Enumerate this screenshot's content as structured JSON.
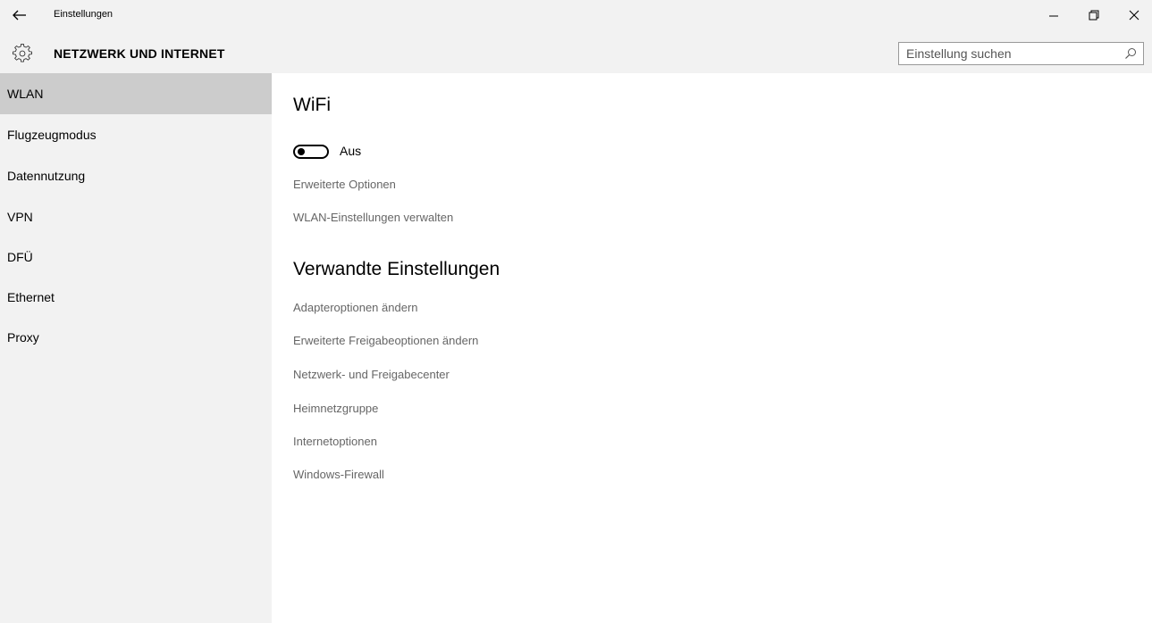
{
  "window": {
    "title": "Einstellungen",
    "controls": {
      "back": "arrow-left-icon",
      "minimize": "minimize-icon",
      "maximize": "restore-icon",
      "close": "close-icon"
    }
  },
  "header": {
    "icon": "gear-icon",
    "title": "NETZWERK UND INTERNET",
    "search": {
      "placeholder": "Einstellung suchen",
      "value": "",
      "icon": "search-icon"
    }
  },
  "sidebar": {
    "items": [
      {
        "label": "WLAN",
        "selected": true
      },
      {
        "label": "Flugzeugmodus",
        "selected": false
      },
      {
        "label": "Datennutzung",
        "selected": false
      },
      {
        "label": "VPN",
        "selected": false
      },
      {
        "label": "DFÜ",
        "selected": false
      },
      {
        "label": "Ethernet",
        "selected": false
      },
      {
        "label": "Proxy",
        "selected": false
      }
    ]
  },
  "main": {
    "wifi": {
      "heading": "WiFi",
      "toggle": {
        "state": "off",
        "label": "Aus"
      },
      "links": [
        "Erweiterte Optionen",
        "WLAN-Einstellungen verwalten"
      ]
    },
    "related": {
      "heading": "Verwandte Einstellungen",
      "links": [
        "Adapteroptionen ändern",
        "Erweiterte Freigabeoptionen ändern",
        "Netzwerk- und Freigabecenter",
        "Heimnetzgruppe",
        "Internetoptionen",
        "Windows-Firewall"
      ]
    }
  },
  "colors": {
    "header_bg": "#f2f2f2",
    "sidebar_bg": "#f2f2f2",
    "selected_bg": "#cccccc",
    "link_text": "#666666",
    "content_bg": "#ffffff"
  }
}
